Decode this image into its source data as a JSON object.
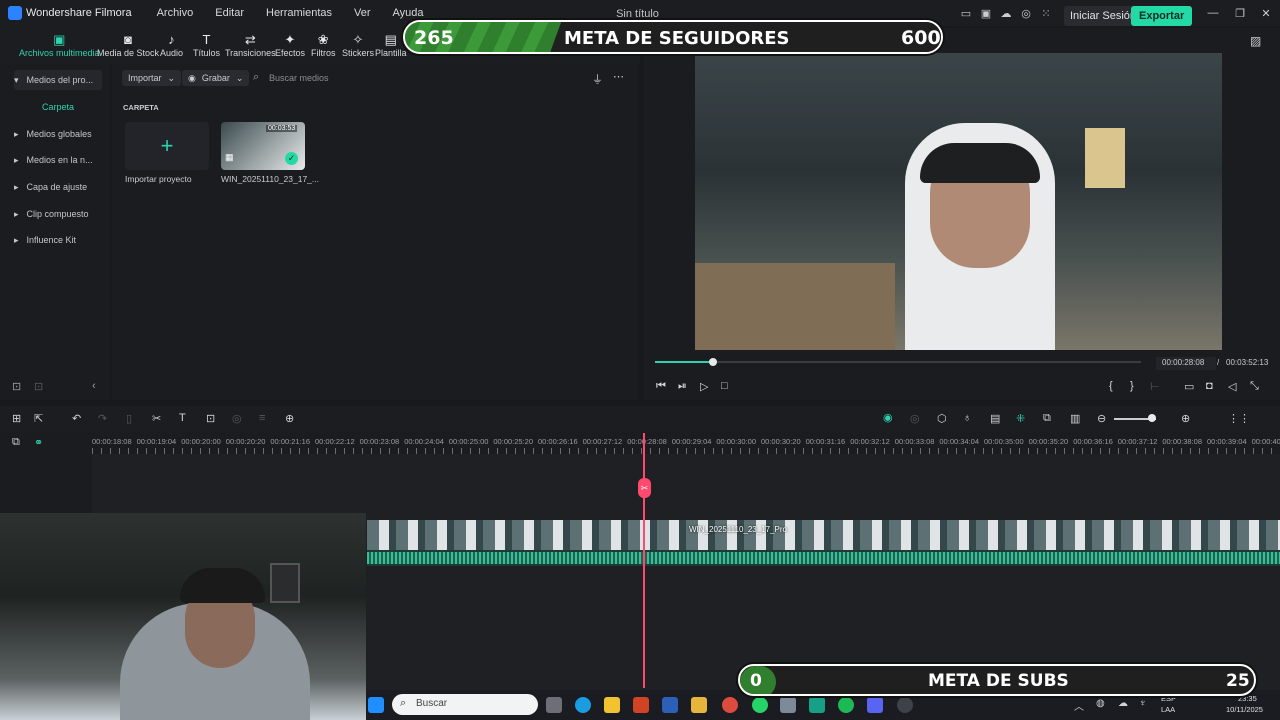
{
  "app": {
    "name": "Wondershare Filmora",
    "window_title": "Sin título"
  },
  "menu": [
    "Archivo",
    "Editar",
    "Herramientas",
    "Ver",
    "Ayuda"
  ],
  "header": {
    "login_label": "Iniciar Sesión",
    "export_label": "Exportar"
  },
  "toolbar": [
    {
      "label": "Archivos multimedia",
      "icon": "media-icon",
      "active": true
    },
    {
      "label": "Media de Stock",
      "icon": "stock-icon"
    },
    {
      "label": "Audio",
      "icon": "music-icon"
    },
    {
      "label": "Títulos",
      "icon": "text-icon"
    },
    {
      "label": "Transiciones",
      "icon": "transition-icon"
    },
    {
      "label": "Efectos",
      "icon": "effects-icon"
    },
    {
      "label": "Filtros",
      "icon": "filters-icon"
    },
    {
      "label": "Stickers",
      "icon": "stickers-icon"
    },
    {
      "label": "Plantilla",
      "icon": "template-icon"
    }
  ],
  "sidebar": {
    "items": [
      {
        "label": "Medios del pro..."
      },
      {
        "label": "Carpeta"
      },
      {
        "label": "Medios globales"
      },
      {
        "label": "Medios en la n..."
      },
      {
        "label": "Capa de ajuste"
      },
      {
        "label": "Clip compuesto"
      },
      {
        "label": "Influence Kit"
      }
    ]
  },
  "media_panel": {
    "import_label": "Importar",
    "record_label": "Grabar",
    "search_placeholder": "Buscar medios",
    "folder_heading": "CARPETA",
    "import_project_label": "Importar proyecto",
    "clip_name": "WIN_20251110_23_17_...",
    "clip_duration": "00:03:53"
  },
  "preview": {
    "current_time": "00:00:28:08",
    "separator": "/",
    "total_time": "00:03:52:13",
    "progress": 0.12
  },
  "timeline": {
    "ruler": [
      "00:00:18:08",
      "00:00:19:04",
      "00:00:20:00",
      "00:00:20:20",
      "00:00:21:16",
      "00:00:22:12",
      "00:00:23:08",
      "00:00:24:04",
      "00:00:25:00",
      "00:00:25:20",
      "00:00:26:16",
      "00:00:27:12",
      "00:00:28:08",
      "00:00:29:04",
      "00:00:30:00",
      "00:00:30:20",
      "00:00:31:16",
      "00:00:32:12",
      "00:00:33:08",
      "00:00:34:04",
      "00:00:35:00",
      "00:00:35:20",
      "00:00:36:16",
      "00:00:37:12",
      "00:00:38:08",
      "00:00:39:04",
      "00:00:40"
    ],
    "clip_label": "WIN_20251110_23_17_Pro"
  },
  "overlays": {
    "followers_goal": {
      "current": "265",
      "title": "META DE SEGUIDORES",
      "target": "600"
    },
    "subs_goal": {
      "current": "0",
      "title": "META DE SUBS",
      "target": "25"
    }
  },
  "taskbar": {
    "search_placeholder": "Buscar",
    "lang": "ESP",
    "lang2": "LAA",
    "time": "23:35",
    "date": "10/11/2025"
  },
  "colors": {
    "accent": "#2bd3b0",
    "playhead": "#ff4a6e",
    "banner_green": "#3a8f34"
  }
}
